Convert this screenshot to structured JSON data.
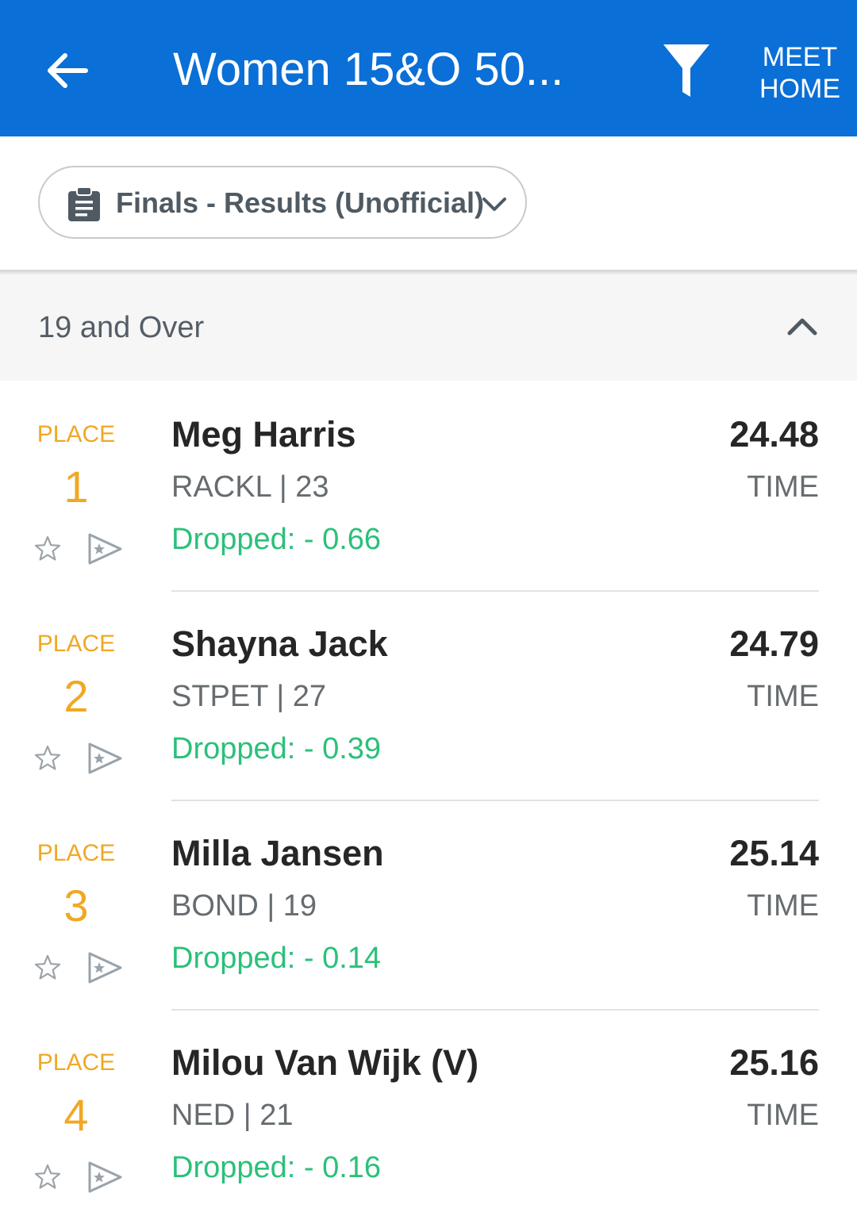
{
  "header": {
    "title": "Women 15&O 50...",
    "meet_home_line1": "MEET",
    "meet_home_line2": "HOME"
  },
  "selector": {
    "label": "Finals - Results (Unofficial)"
  },
  "group": {
    "title": "19 and Over"
  },
  "results": [
    {
      "place_label": "PLACE",
      "place": "1",
      "name": "Meg Harris",
      "club": "RACKL | 23",
      "dropped": "Dropped: - 0.66",
      "time": "24.48",
      "time_label": "TIME"
    },
    {
      "place_label": "PLACE",
      "place": "2",
      "name": "Shayna Jack",
      "club": "STPET | 27",
      "dropped": "Dropped: - 0.39",
      "time": "24.79",
      "time_label": "TIME"
    },
    {
      "place_label": "PLACE",
      "place": "3",
      "name": "Milla Jansen",
      "club": "BOND | 19",
      "dropped": "Dropped: - 0.14",
      "time": "25.14",
      "time_label": "TIME"
    },
    {
      "place_label": "PLACE",
      "place": "4",
      "name": "Milou Van Wijk (V)",
      "club": "NED | 21",
      "dropped": "Dropped: - 0.16",
      "time": "25.16",
      "time_label": "TIME"
    }
  ],
  "colors": {
    "appbar": "#0a6fd6",
    "place": "#f0a824",
    "dropped": "#2bc07a"
  },
  "icons": [
    "back-arrow-icon",
    "filter-icon",
    "clipboard-icon",
    "chevron-down-icon",
    "chevron-up-icon",
    "star-icon",
    "flag-icon"
  ]
}
